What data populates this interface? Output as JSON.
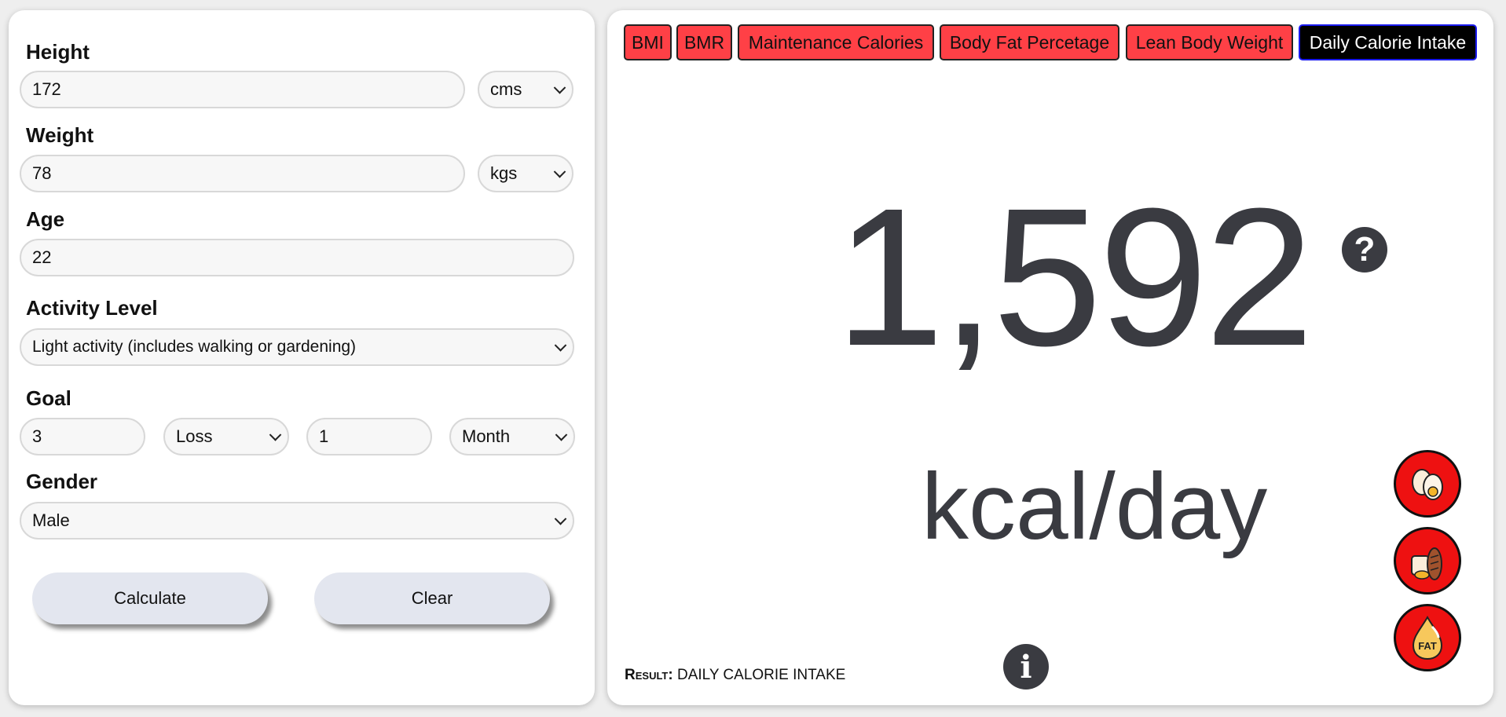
{
  "form": {
    "height": {
      "label": "Height",
      "value": "172",
      "unit": "cms"
    },
    "weight": {
      "label": "Weight",
      "value": "78",
      "unit": "kgs"
    },
    "age": {
      "label": "Age",
      "value": "22"
    },
    "activity": {
      "label": "Activity Level",
      "value": "Light activity (includes walking or gardening)"
    },
    "goal": {
      "label": "Goal",
      "amount": "3",
      "direction": "Loss",
      "period_count": "1",
      "period_unit": "Month"
    },
    "gender": {
      "label": "Gender",
      "value": "Male"
    },
    "calculate_label": "Calculate",
    "clear_label": "Clear"
  },
  "tabs": [
    {
      "label": "BMI",
      "active": false
    },
    {
      "label": "BMR",
      "active": false
    },
    {
      "label": "Maintenance Calories",
      "active": false
    },
    {
      "label": "Body Fat Percetage",
      "active": false
    },
    {
      "label": "Lean Body Weight",
      "active": false
    },
    {
      "label": "Daily Calorie Intake",
      "active": true
    }
  ],
  "result": {
    "value": "1,592",
    "unit": "kcal/day",
    "label_key": "Result:",
    "label_value": "Daily Calorie Intake"
  },
  "icons": {
    "help": "question-circle-icon",
    "info": "info-circle-icon",
    "macros": [
      "protein-egg-icon",
      "carbs-bread-icon",
      "fat-drop-icon"
    ]
  },
  "colors": {
    "tab_bg": "#ff4046",
    "tab_active_bg": "#000000",
    "tab_active_border": "#1a1aee",
    "macro_bg": "#ee1111",
    "value_text": "#3a3b41",
    "button_bg": "#e3e6ef"
  }
}
